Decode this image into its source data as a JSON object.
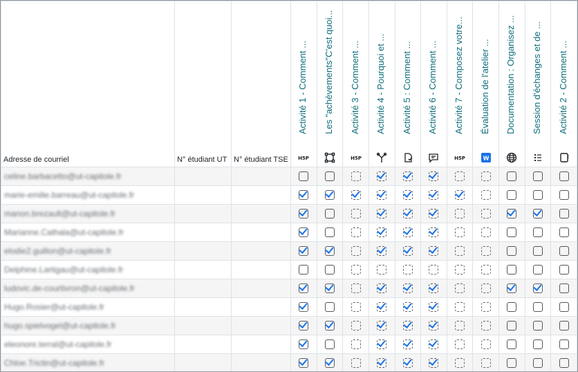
{
  "columns": {
    "email": "Adresse de courriel",
    "student_ut": "N° étudiant UT",
    "student_tse": "N° étudiant TSE"
  },
  "activities": [
    {
      "title": "Activité 1 - Comment ...",
      "icon": "h5p-icon",
      "tracking": "manual"
    },
    {
      "title": "Les \"achèvements\"C'est quoi...",
      "icon": "selection-icon",
      "tracking": "manual"
    },
    {
      "title": "Activité 3 - Comment ...",
      "icon": "h5p-icon",
      "tracking": "auto"
    },
    {
      "title": "Activité 4 - Pourquoi et ...",
      "icon": "workshop-icon",
      "tracking": "auto"
    },
    {
      "title": "Activité 5 : Comment ...",
      "icon": "assignment-icon",
      "tracking": "auto"
    },
    {
      "title": "Activité 6 - Comment ...",
      "icon": "forum-icon",
      "tracking": "auto"
    },
    {
      "title": "Activité 7 - Composez votre...",
      "icon": "h5p-icon",
      "tracking": "auto"
    },
    {
      "title": "Évaluation de l'atelier ...",
      "icon": "wiki-icon",
      "tracking": "auto"
    },
    {
      "title": "Documentation : Organisez ...",
      "icon": "globe-icon",
      "tracking": "manual"
    },
    {
      "title": "Session d'échanges et de ...",
      "icon": "list-icon",
      "tracking": "manual"
    },
    {
      "title": "Activité 2 - Comment ...",
      "icon": "book-icon",
      "tracking": "manual"
    }
  ],
  "rows": [
    {
      "email": "celine.barbacetto@ut-capitole.fr",
      "done": [
        0,
        0,
        0,
        1,
        1,
        1,
        0,
        0,
        0,
        0,
        0
      ]
    },
    {
      "email": "marie-emilie.barreau@ut-capitole.fr",
      "done": [
        1,
        1,
        1,
        1,
        1,
        1,
        1,
        0,
        0,
        0,
        0
      ]
    },
    {
      "email": "manon.brezault@ut-capitole.fr",
      "done": [
        1,
        0,
        0,
        1,
        1,
        1,
        0,
        0,
        1,
        1,
        0
      ]
    },
    {
      "email": "Marianne.Cathala@ut-capitole.fr",
      "done": [
        1,
        0,
        0,
        1,
        1,
        1,
        0,
        0,
        0,
        0,
        0
      ]
    },
    {
      "email": "elodie2.guillon@ut-capitole.fr",
      "done": [
        1,
        1,
        0,
        1,
        1,
        1,
        0,
        0,
        0,
        0,
        0
      ]
    },
    {
      "email": "Delphine.Lartigau@ut-capitole.fr",
      "done": [
        0,
        0,
        0,
        0,
        0,
        0,
        0,
        0,
        0,
        0,
        0
      ]
    },
    {
      "email": "ludovic.de-courtivron@ut-capitole.fr",
      "done": [
        1,
        1,
        0,
        1,
        1,
        1,
        0,
        0,
        1,
        1,
        0
      ]
    },
    {
      "email": "Hugo.Rosier@ut-capitole.fr",
      "done": [
        1,
        0,
        0,
        1,
        1,
        1,
        0,
        0,
        0,
        0,
        0
      ]
    },
    {
      "email": "hugo.spielvogel@ut-capitole.fr",
      "done": [
        1,
        1,
        0,
        1,
        1,
        1,
        0,
        0,
        0,
        0,
        0
      ]
    },
    {
      "email": "eleonore.terral@ut-capitole.fr",
      "done": [
        1,
        0,
        0,
        1,
        1,
        1,
        0,
        0,
        0,
        0,
        0
      ]
    },
    {
      "email": "Chloe.Trictin@ut-capitole.fr",
      "done": [
        1,
        1,
        0,
        1,
        1,
        1,
        0,
        0,
        0,
        0,
        0
      ]
    }
  ]
}
